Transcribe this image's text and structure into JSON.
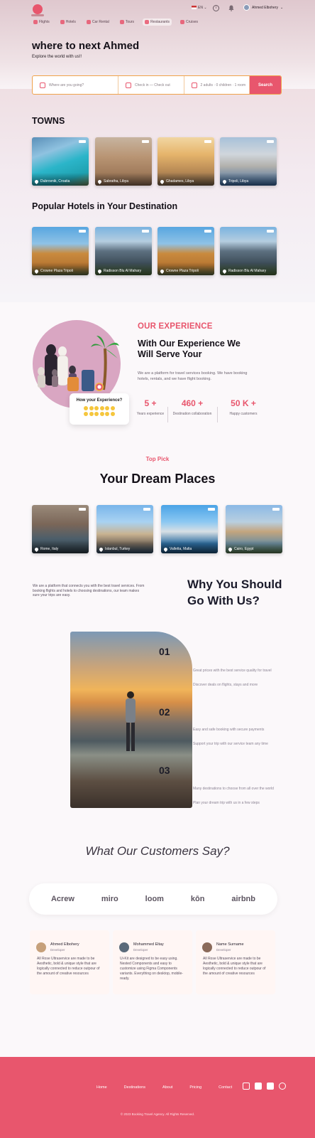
{
  "nav": {
    "lang": "EN",
    "user_name": "Ahmed Elbohery",
    "tabs": [
      {
        "label": "Flights"
      },
      {
        "label": "Hotels"
      },
      {
        "label": "Car Rental"
      },
      {
        "label": "Tours"
      },
      {
        "label": "Restaurants"
      },
      {
        "label": "Cruises"
      }
    ]
  },
  "hero": {
    "title": "where to next Ahmed",
    "subtitle": "Explore the world with us!!"
  },
  "search": {
    "destination_placeholder": "Where are you going?",
    "checkin_placeholder": "Check in — Check out",
    "guests_placeholder": "2 adults · 0 children · 1 room",
    "button": "Search"
  },
  "towns": {
    "title": "TOWNS",
    "items": [
      {
        "label": "Dubrovnik, Croatia"
      },
      {
        "label": "Sabratha, Libya"
      },
      {
        "label": "Ghadames, Libya"
      },
      {
        "label": "Tripoli, Libya"
      }
    ]
  },
  "hotels": {
    "title": "Popular Hotels in Your Destination",
    "items": [
      {
        "label": "Crowne Plaza Tripoli"
      },
      {
        "label": "Radisson Blu Al Mahary"
      },
      {
        "label": "Crowne Plaza Tripoli"
      },
      {
        "label": "Radisson Blu Al Mahary"
      }
    ]
  },
  "experience": {
    "kicker": "OUR EXPERIENCE",
    "title": "With Our Experience We Will Serve Your",
    "description": "We are a platform for travel services booking. We have booking hotels, rentals, and we have flight booking.",
    "question": "How your Experience?",
    "stats": [
      {
        "value": "5 +",
        "label": "Years experience"
      },
      {
        "value": "460 +",
        "label": "Destination collaboration"
      },
      {
        "value": "50 K +",
        "label": "Happy customers"
      }
    ]
  },
  "dream": {
    "kicker": "Top Pick",
    "title": "Your Dream Places",
    "items": [
      {
        "label": "Rome, Italy"
      },
      {
        "label": "Istanbul, Turkey"
      },
      {
        "label": "Valletta, Malta"
      },
      {
        "label": "Cairo, Egypt"
      }
    ]
  },
  "why": {
    "intro": "We are a platform that connects you with the best travel services. From booking flights and hotels to choosing destinations, our team makes sure your trips are easy.",
    "title": "Why You Should Go With Us?",
    "points": [
      {
        "num": "01",
        "line1": "Great prices with the best service quality for travel",
        "line2": "Discover deals on flights, stays and more"
      },
      {
        "num": "02",
        "line1": "Easy and safe booking with secure payments",
        "line2": "Support your trip with our service team any time"
      },
      {
        "num": "03",
        "line1": "Many destinations to choose from all over the world",
        "line2": "Plan your dream trip with us in a few steps"
      }
    ]
  },
  "testimonials": {
    "title": "What Our Customers Say?",
    "logos": [
      "Acrew",
      "miro",
      "loom",
      "kōn",
      "airbnb"
    ],
    "items": [
      {
        "name": "Ahmed Elbohery",
        "role": "Developer",
        "quote": "All Rose Ultraservice are made to be Aesthetic, bold & unique style that are logically connected to reduce outpour of the amount of creative resources"
      },
      {
        "name": "Mohammed Eltay",
        "role": "Developer",
        "quote": "Ui-Kit are designed to be easy using. Nested Components and easy to customize using Figma Components variants. Everything on desktop, mobile-ready."
      },
      {
        "name": "Name Surname",
        "role": "Developer",
        "quote": "All Rose Ultraservice are made to be Aesthetic, bold & unique style that are logically connected to reduce outpour of the amount of creative resources"
      }
    ]
  },
  "footer": {
    "links": [
      "Home",
      "Destinations",
      "About",
      "Pricing",
      "Contact"
    ],
    "copyright": "© 2023 Booking Travel Agency. All Rights Reserved."
  },
  "colors": {
    "accent": "#e8566d",
    "search_border": "#f0a24a"
  }
}
